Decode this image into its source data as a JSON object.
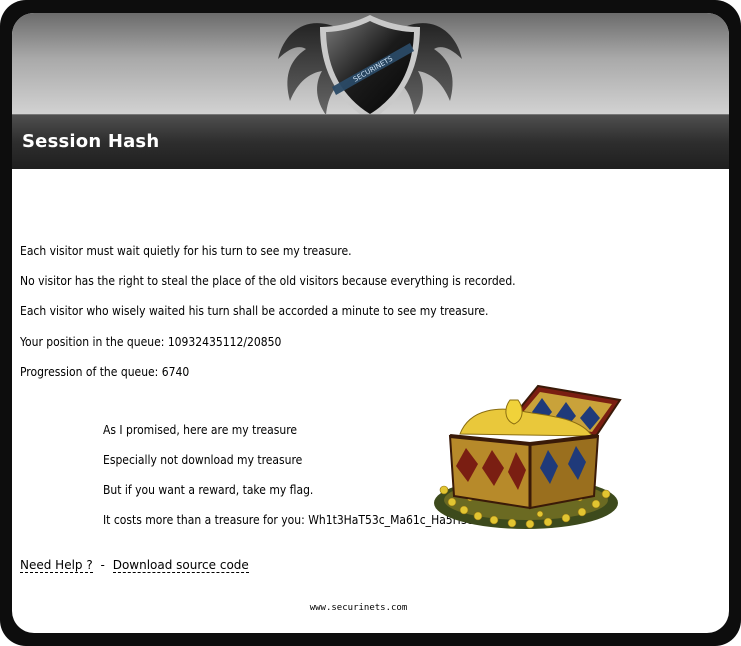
{
  "header": {
    "logo_text": "SECURINETS",
    "title": "Session Hash"
  },
  "main": {
    "paragraphs": [
      "Each visitor must wait quietly for his turn to see my treasure.",
      "No visitor has the right to steal the place of the old visitors because everything is recorded.",
      "Each visitor who wisely waited his turn shall be accorded a minute to see my treasure.",
      "Your position in the queue: 10932435112/20850",
      "Progression of the queue: 6740"
    ],
    "treasure_lines": [
      "As I promised, here are my treasure",
      "Especially not download my treasure",
      "But if you want a reward, take my flag.",
      "It costs more than a treasure for you: Wh1t3HaT53c_Ma61c_Ha5H35"
    ],
    "treasure_image": "treasure-chest-image"
  },
  "links": {
    "help": "Need Help ?",
    "separator": "-",
    "download": "Download source code"
  },
  "footer": {
    "site": "www.securinets.com"
  }
}
